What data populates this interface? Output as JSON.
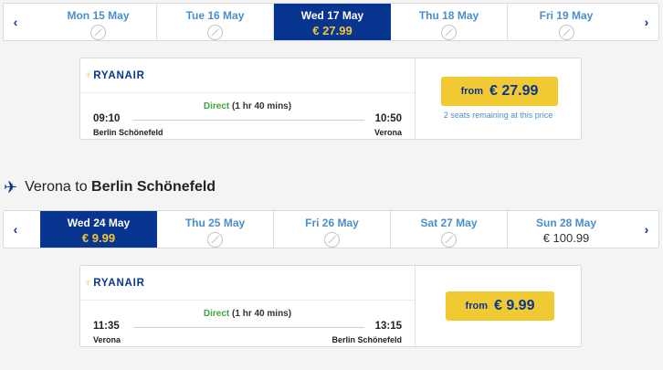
{
  "outbound": {
    "dates": [
      {
        "label": "Mon 15 May",
        "price": null,
        "selected": false
      },
      {
        "label": "Tue 16 May",
        "price": null,
        "selected": false
      },
      {
        "label": "Wed 17 May",
        "price": "€ 27.99",
        "selected": true
      },
      {
        "label": "Thu 18 May",
        "price": null,
        "selected": false
      },
      {
        "label": "Fri 19 May",
        "price": null,
        "selected": false
      }
    ],
    "flight": {
      "airline": "RYANAIR",
      "direct_label": "Direct",
      "duration": "(1 hr 40 mins)",
      "departure_time": "09:10",
      "arrival_time": "10:50",
      "departure_city": "Berlin Schönefeld",
      "arrival_city": "Verona",
      "price_from": "from",
      "price": "€ 27.99",
      "seats_note": "2 seats remaining at this price"
    }
  },
  "inbound": {
    "heading_from": "Verona to",
    "heading_to": "Berlin Schönefeld",
    "icon": "plane-icon",
    "dates": [
      {
        "label": "Wed 24 May",
        "price": "€ 9.99",
        "selected": true
      },
      {
        "label": "Thu 25 May",
        "price": null,
        "selected": false
      },
      {
        "label": "Fri 26 May",
        "price": null,
        "selected": false
      },
      {
        "label": "Sat 27 May",
        "price": null,
        "selected": false
      },
      {
        "label": "Sun 28 May",
        "price": "€ 100.99",
        "selected": false
      }
    ],
    "flight": {
      "airline": "RYANAIR",
      "direct_label": "Direct",
      "duration": "(1 hr 40 mins)",
      "departure_time": "11:35",
      "arrival_time": "13:15",
      "departure_city": "Verona",
      "arrival_city": "Berlin Schönefeld",
      "price_from": "from",
      "price": "€ 9.99"
    }
  },
  "nav": {
    "prev": "‹",
    "next": "›"
  },
  "colors": {
    "brand_blue": "#073590",
    "accent_yellow": "#f1c933",
    "link_blue": "#4a8fcc",
    "direct_green": "#3da83f"
  }
}
